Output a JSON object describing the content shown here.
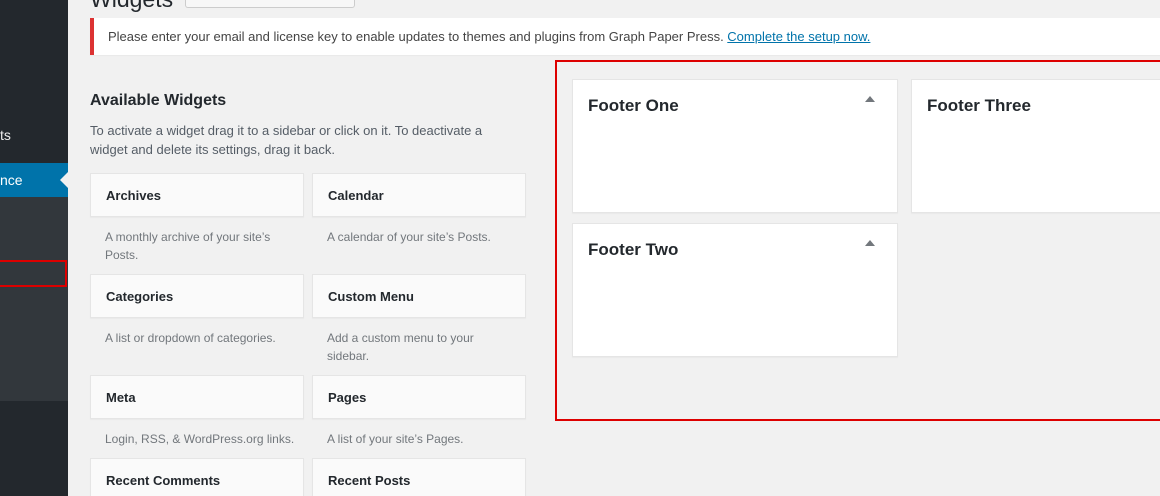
{
  "page": {
    "title": "Widgets"
  },
  "admin_menu": {
    "partial_item_label": "ts",
    "current_item_label": "nce"
  },
  "notice": {
    "text": "Please enter your email and license key to enable updates to themes and plugins from Graph Paper Press. ",
    "link": "Complete the setup now."
  },
  "available_widgets": {
    "title": "Available Widgets",
    "description": "To activate a widget drag it to a sidebar or click on it. To deactivate a widget and delete its settings, drag it back.",
    "items": [
      {
        "title": "Archives",
        "description": "A monthly archive of your site’s Posts."
      },
      {
        "title": "Calendar",
        "description": "A calendar of your site’s Posts."
      },
      {
        "title": "Categories",
        "description": "A list or dropdown of categories."
      },
      {
        "title": "Custom Menu",
        "description": "Add a custom menu to your sidebar."
      },
      {
        "title": "Meta",
        "description": "Login, RSS, & WordPress.org links."
      },
      {
        "title": "Pages",
        "description": "A list of your site’s Pages."
      },
      {
        "title": "Recent Comments",
        "description": ""
      },
      {
        "title": "Recent Posts",
        "description": ""
      }
    ]
  },
  "sidebars": [
    {
      "title": "Footer One"
    },
    {
      "title": "Footer Three"
    },
    {
      "title": "Footer Two"
    }
  ],
  "colors": {
    "admin_sidebar": "#23282d",
    "admin_current": "#0073aa",
    "notice_error": "#dc3232",
    "highlight": "#dd0000",
    "link": "#0073aa"
  }
}
